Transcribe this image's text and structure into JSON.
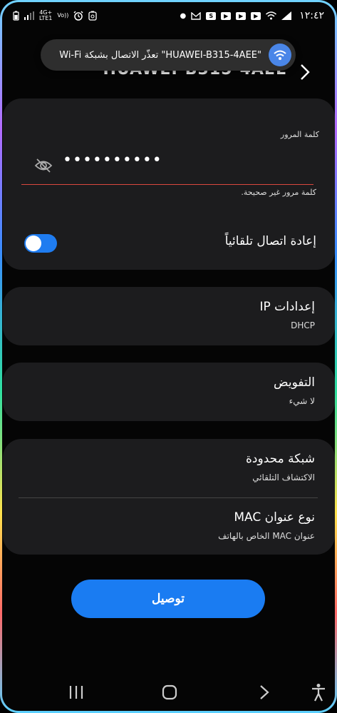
{
  "status": {
    "network_type_top": "4G+",
    "network_type_bottom": "LTE1",
    "volte_top": "Vo))",
    "time": "١٢:٤٢"
  },
  "toast": {
    "message": "\"HUAWEI-B315-4AEE\" تعذّر الاتصال بشبكة Wi-Fi"
  },
  "header": {
    "network_name": "HUAWEI-B315-4AEE"
  },
  "password": {
    "label": "كلمة المرور",
    "value": "••••••••••",
    "error": "كلمة مرور غير صحيحة."
  },
  "auto_reconnect": {
    "label": "إعادة اتصال تلقائياً",
    "enabled": true
  },
  "ip_settings": {
    "title": "إعدادات IP",
    "value": "DHCP"
  },
  "proxy": {
    "title": "التفويض",
    "value": "لا شيء"
  },
  "metered": {
    "title": "شبكة محدودة",
    "value": "الاكتشاف التلقائي"
  },
  "mac_type": {
    "title": "نوع عنوان MAC",
    "value": "عنوان MAC الخاص بالهاتف"
  },
  "actions": {
    "connect_label": "توصيل"
  },
  "colors": {
    "accent": "#1a7cf2",
    "error_underline": "#d9473e",
    "card_bg": "#1c1c1e"
  }
}
